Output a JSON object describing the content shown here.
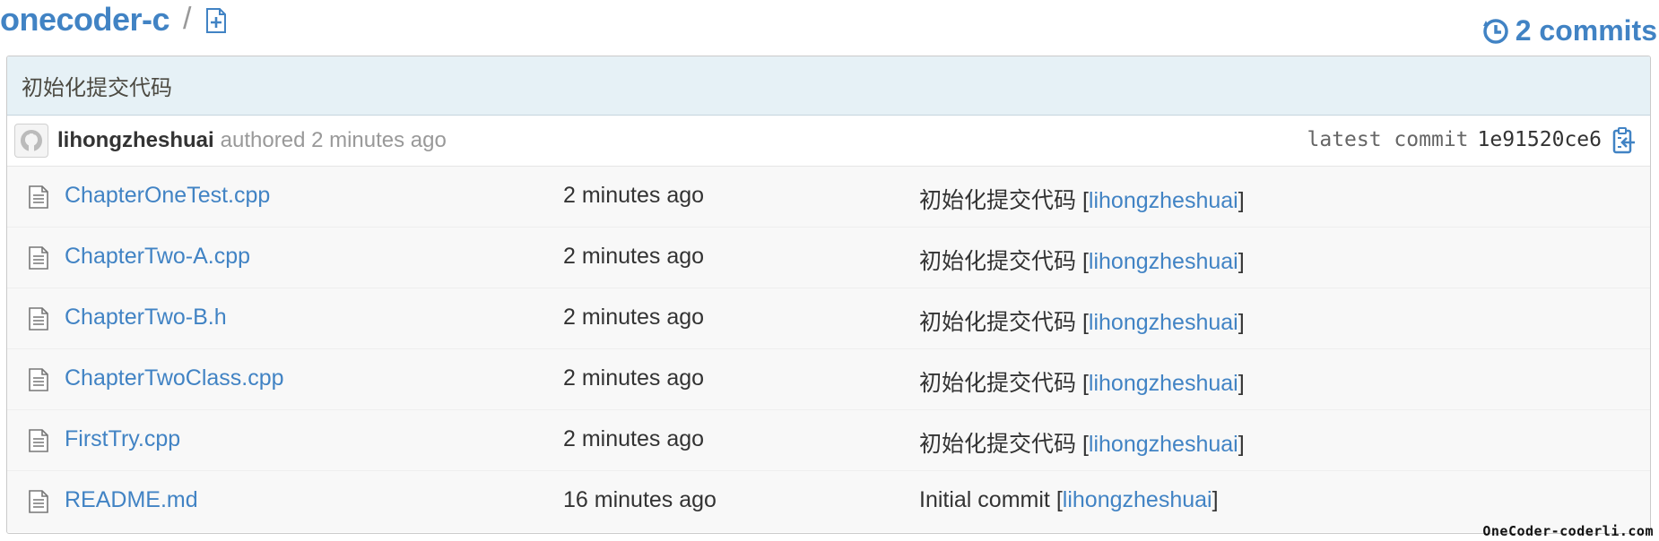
{
  "repo": {
    "name": "onecoder-c",
    "separator": "/"
  },
  "commits_link": {
    "label": "2 commits"
  },
  "last_commit": {
    "message": "初始化提交代码",
    "author": "lihongzheshuai",
    "authored_text": "authored 2 minutes ago",
    "latest_label": "latest commit",
    "sha": "1e91520ce6"
  },
  "files": [
    {
      "name": "ChapterOneTest.cpp",
      "age": "2 minutes ago",
      "message": "初始化提交代码",
      "author": "lihongzheshuai"
    },
    {
      "name": "ChapterTwo-A.cpp",
      "age": "2 minutes ago",
      "message": "初始化提交代码",
      "author": "lihongzheshuai"
    },
    {
      "name": "ChapterTwo-B.h",
      "age": "2 minutes ago",
      "message": "初始化提交代码",
      "author": "lihongzheshuai"
    },
    {
      "name": "ChapterTwoClass.cpp",
      "age": "2 minutes ago",
      "message": "初始化提交代码",
      "author": "lihongzheshuai"
    },
    {
      "name": "FirstTry.cpp",
      "age": "2 minutes ago",
      "message": "初始化提交代码",
      "author": "lihongzheshuai"
    },
    {
      "name": "README.md",
      "age": "16 minutes ago",
      "message": "Initial commit",
      "author": "lihongzheshuai"
    }
  ],
  "watermark": "OneCoder-coderli.com",
  "icons": {
    "add_file": "add-file-icon",
    "history": "history-icon",
    "avatar": "octocat-avatar",
    "clipboard": "clipboard-icon",
    "file": "file-text-icon"
  },
  "colors": {
    "link": "#4183c4",
    "commit_title_bg": "#e6f1f6",
    "row_bg": "#f8f8f8"
  }
}
